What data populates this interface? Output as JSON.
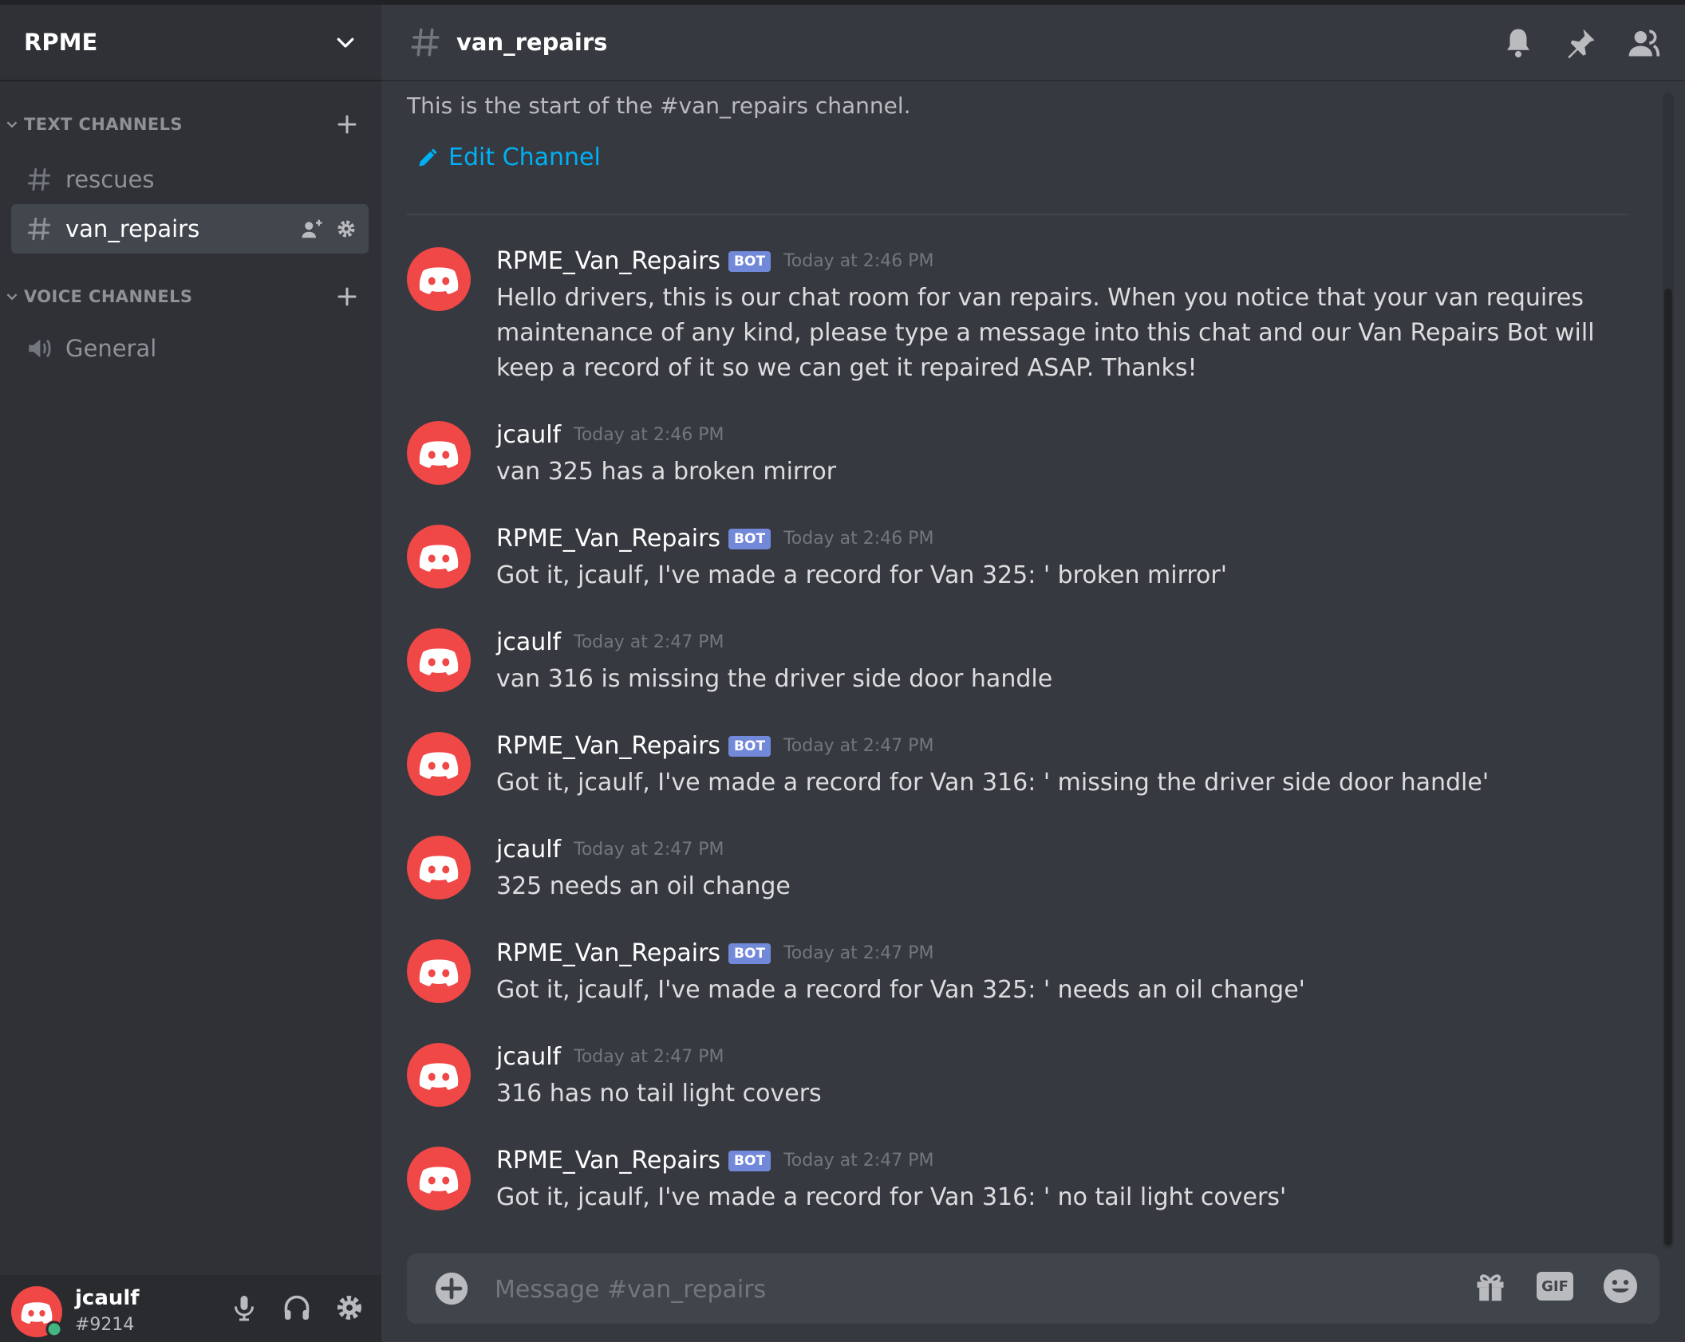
{
  "server": {
    "name": "RPME"
  },
  "categories": {
    "text": "TEXT CHANNELS",
    "voice": "VOICE CHANNELS"
  },
  "channels": {
    "text": [
      {
        "name": "rescues"
      },
      {
        "name": "van_repairs",
        "active": true
      }
    ],
    "voice": [
      {
        "name": "General"
      }
    ]
  },
  "header": {
    "channel_name": "van_repairs"
  },
  "intro": {
    "text": "This is the start of the #van_repairs channel.",
    "edit_label": "Edit Channel"
  },
  "bot_tag": "BOT",
  "messages": [
    {
      "author": "RPME_Van_Repairs",
      "bot": true,
      "time": "Today at 2:46 PM",
      "text": "Hello drivers, this is our chat room for van repairs. When you notice that your van requires maintenance of any kind, please type a message into this chat and our Van Repairs Bot will keep a record of it so we can get it repaired ASAP. Thanks!"
    },
    {
      "author": "jcaulf",
      "bot": false,
      "time": "Today at 2:46 PM",
      "text": "van 325 has a broken mirror"
    },
    {
      "author": "RPME_Van_Repairs",
      "bot": true,
      "time": "Today at 2:46 PM",
      "text": "Got it, jcaulf, I've made a record for Van 325:  ' broken mirror'"
    },
    {
      "author": "jcaulf",
      "bot": false,
      "time": "Today at 2:47 PM",
      "text": "van 316 is missing the driver side door handle"
    },
    {
      "author": "RPME_Van_Repairs",
      "bot": true,
      "time": "Today at 2:47 PM",
      "text": "Got it, jcaulf, I've made a record for Van 316:  ' missing the driver side door handle'"
    },
    {
      "author": "jcaulf",
      "bot": false,
      "time": "Today at 2:47 PM",
      "text": "325 needs an oil change"
    },
    {
      "author": "RPME_Van_Repairs",
      "bot": true,
      "time": "Today at 2:47 PM",
      "text": "Got it, jcaulf, I've made a record for Van 325:  ' needs an oil change'"
    },
    {
      "author": "jcaulf",
      "bot": false,
      "time": "Today at 2:47 PM",
      "text": "316 has no tail light covers"
    },
    {
      "author": "RPME_Van_Repairs",
      "bot": true,
      "time": "Today at 2:47 PM",
      "text": "Got it, jcaulf, I've made a record for Van 316:  ' no tail light covers'"
    }
  ],
  "composer": {
    "placeholder": "Message #van_repairs",
    "gif_label": "GIF"
  },
  "user": {
    "name": "jcaulf",
    "tag": "#9214",
    "status_color": "#43b581"
  },
  "colors": {
    "accent": "#7289da",
    "avatar": "#f04747",
    "link": "#00b0f4"
  },
  "icons": {
    "header": [
      "bell-icon",
      "pin-icon",
      "members-icon"
    ],
    "composer": [
      "gift-icon",
      "gif-icon",
      "emoji-icon"
    ],
    "user": [
      "microphone-icon",
      "headphones-icon",
      "settings-gear-icon"
    ]
  }
}
